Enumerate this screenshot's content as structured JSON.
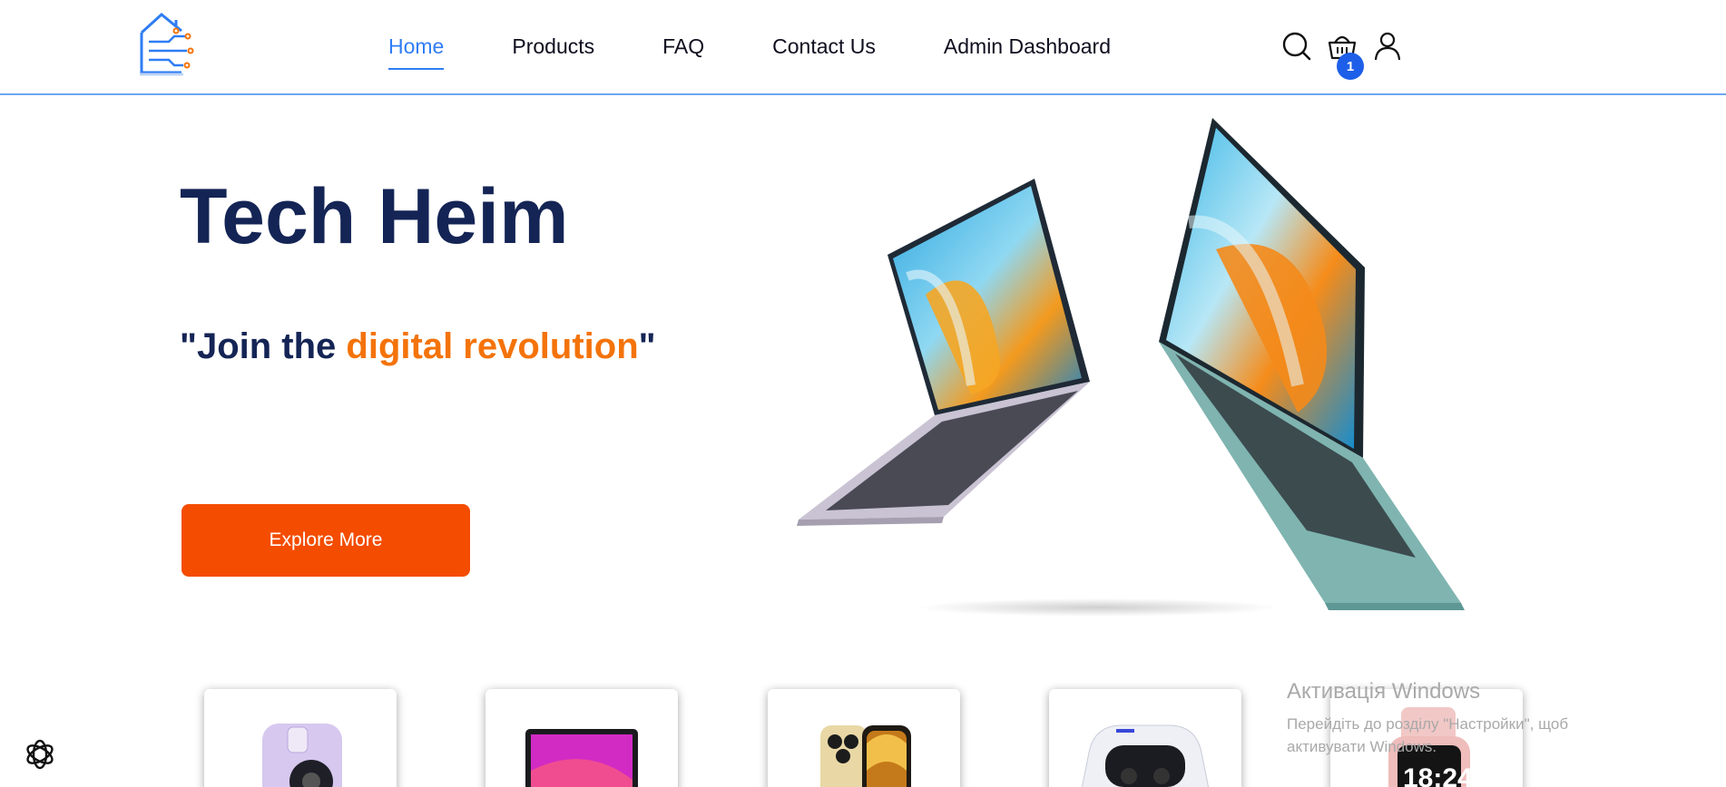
{
  "brand": {
    "logo_icon": "house-circuit-logo",
    "colors": {
      "primary": "#2f7df4",
      "accent": "#f4730a",
      "button": "#f44c00",
      "heading": "#142455"
    }
  },
  "nav": {
    "items": [
      {
        "label": "Home",
        "active": true
      },
      {
        "label": "Products",
        "active": false
      },
      {
        "label": "FAQ",
        "active": false
      },
      {
        "label": "Contact Us",
        "active": false
      },
      {
        "label": "Admin Dashboard",
        "active": false
      }
    ]
  },
  "header_icons": {
    "search": "search-icon",
    "cart": "basket-icon",
    "account": "user-icon",
    "cart_count": "1"
  },
  "hero": {
    "title": "Tech Heim",
    "quote_prefix": "\"Join the ",
    "quote_accent": "digital revolution",
    "quote_suffix": "\"",
    "cta_label": "Explore More",
    "image": "laptops-image"
  },
  "products": [
    {
      "name": "instant-camera"
    },
    {
      "name": "laptop"
    },
    {
      "name": "smartphone"
    },
    {
      "name": "game-controller"
    },
    {
      "name": "smartwatch"
    }
  ],
  "watermark": {
    "title": "Активація Windows",
    "text": "Перейдіть до розділу \"Настройки\", щоб активувати Windows."
  }
}
